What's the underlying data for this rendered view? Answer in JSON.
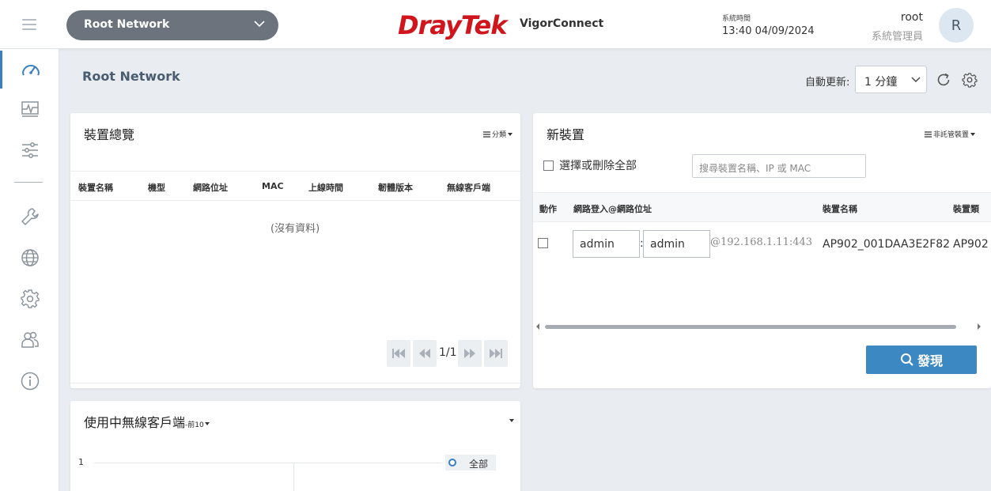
{
  "header": {
    "network_select": "Root Network",
    "brand": "DrayTek",
    "app_name": "VigorConnect",
    "sys_time_label": "系統時間",
    "sys_time_value": "13:40 04/09/2024",
    "user_name": "root",
    "user_role": "系統管理員",
    "avatar_letter": "R"
  },
  "sidebar": {
    "items": [
      "dashboard-icon",
      "monitor-icon",
      "sliders-icon",
      "wrench-icon",
      "globe-icon",
      "gear-icon",
      "users-icon",
      "info-icon"
    ],
    "active_index": 0
  },
  "main": {
    "title": "Root Network",
    "auto_refresh_label": "自動更新:",
    "auto_refresh_value": "1 分鐘"
  },
  "device_overview": {
    "title": "裝置總覽",
    "menu_label": "分類",
    "columns": [
      "裝置名稱",
      "機型",
      "網路位址",
      "MAC",
      "上線時間",
      "韌體版本",
      "無線客戶端"
    ],
    "no_data": "(沒有資料)",
    "page_indicator": "1/1"
  },
  "new_devices": {
    "title": "新裝置",
    "menu_label": "非託管裝置",
    "select_all_label": "選擇或刪除全部",
    "search_placeholder": "搜尋裝置名稱、IP 或 MAC",
    "columns": [
      "動作",
      "網路登入@網路位址",
      "裝置名稱",
      "裝置類"
    ],
    "rows": [
      {
        "username": "admin",
        "password": "admin",
        "address": "@192.168.1.11:443",
        "device_name": "AP902_001DAA3E2F82",
        "device_type": "AP902"
      }
    ],
    "separator": ":",
    "discover_label": "發現"
  },
  "wireless_clients": {
    "title": "使用中無線客戶端",
    "top_label": "-前10",
    "y_tick": "1",
    "legend_label": "全部"
  },
  "colors": {
    "brand_red": "#d0151c",
    "accent_blue": "#3b88c3",
    "pill_gray": "#6c737c"
  }
}
